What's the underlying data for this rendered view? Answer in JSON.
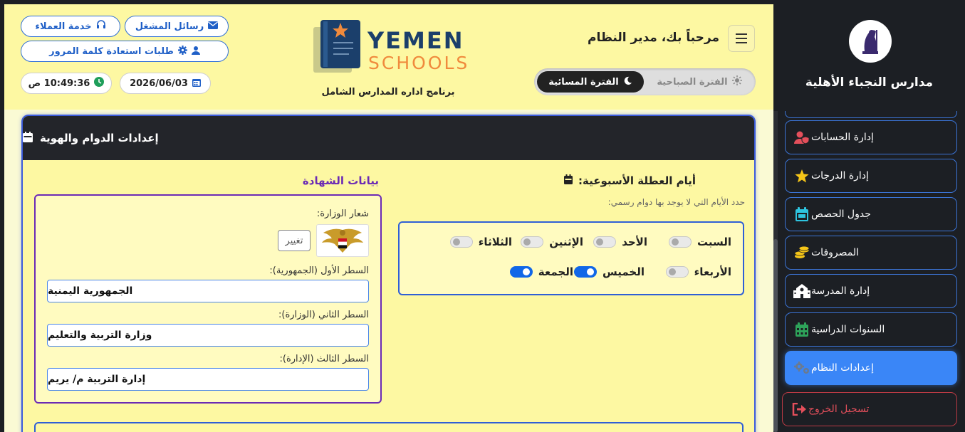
{
  "sidebar": {
    "school_name": "مدارس النجباء الأهلية",
    "items": [
      {
        "label": "إدارة الحسابات",
        "icon": "user-shield-icon"
      },
      {
        "label": "إدارة الدرجات",
        "icon": "star-icon"
      },
      {
        "label": "جدول الحصص",
        "icon": "calendar-icon"
      },
      {
        "label": "المصروفات",
        "icon": "coins-icon"
      },
      {
        "label": "إدارة المدرسة",
        "icon": "school-icon"
      },
      {
        "label": "السنوات الدراسية",
        "icon": "calendar-grid-icon"
      },
      {
        "label": "إعدادات النظام",
        "icon": "gears-icon"
      },
      {
        "label": "تسجيل الخروج",
        "icon": "logout-icon"
      }
    ]
  },
  "header": {
    "welcome": "مرحباً بك، مدير النظام",
    "shift": {
      "morning": "الفترة الصباحية",
      "evening": "الفترة المسائية"
    },
    "brand": {
      "line1": "YEMEN",
      "line2": "SCHOOLS",
      "subtitle": "برنامج اداره المدارس الشامل"
    },
    "buttons": {
      "customer_service": "خدمة العملاء",
      "operator_messages": "رسائل المشغل",
      "password_requests": "طلبات استعادة كلمة المرور"
    },
    "date": "2026/06/03",
    "time": "10:49:36 ص"
  },
  "card": {
    "title": "إعدادات الدوام والهوية",
    "holidays": {
      "title": "أيام العطلة الأسبوعية:",
      "hint": "حدد الأيام التي لا يوجد بها دوام رسمي:",
      "days": [
        {
          "name": "السبت",
          "on": false
        },
        {
          "name": "الأحد",
          "on": false
        },
        {
          "name": "الإثنين",
          "on": false
        },
        {
          "name": "الثلاثاء",
          "on": false
        },
        {
          "name": "الأربعاء",
          "on": false
        },
        {
          "name": "الخميس",
          "on": true
        },
        {
          "name": "الجمعة",
          "on": true
        }
      ]
    },
    "certificate": {
      "title": "بيانات الشهادة",
      "logo_label": "شعار الوزارة:",
      "change_button": "تغيير",
      "line1_label": "السطر الأول (الجمهورية):",
      "line1_value": "الجمهورية اليمنية",
      "line2_label": "السطر الثاني (الوزارة):",
      "line2_value": "وزارة التربية والتعليم",
      "line3_label": "السطر الثالث (الإدارة):",
      "line3_value": "إدارة التربية م/ يريم"
    }
  },
  "colors": {
    "accent": "#3a86f7",
    "header_bg": "#fdf8a2",
    "sidebar_bg": "#1c1f24",
    "danger": "#e34f5b",
    "purple": "#6b2ab5"
  }
}
